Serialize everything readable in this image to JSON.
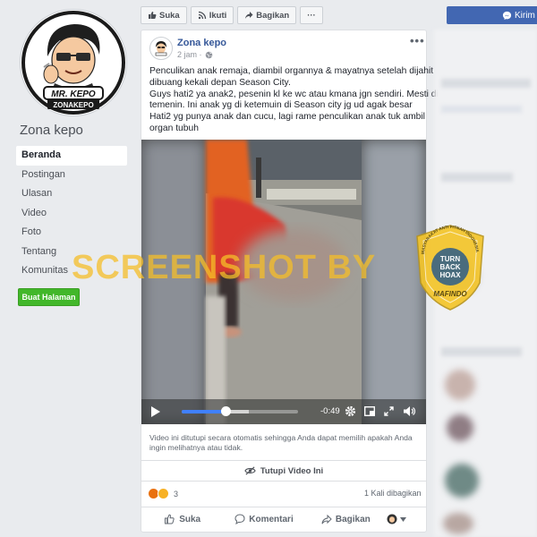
{
  "page": {
    "name": "Zona kepo",
    "logo_text_top": "MR. KEPO",
    "logo_text_bottom": "ZONAKEPO",
    "nav": [
      "Beranda",
      "Postingan",
      "Ulasan",
      "Video",
      "Foto",
      "Tentang",
      "Komunitas"
    ],
    "create_page_label": "Buat Halaman"
  },
  "topbar": {
    "like_label": "Suka",
    "follow_label": "Ikuti",
    "share_label": "Bagikan",
    "more_label": "···",
    "send_label": "Kirim"
  },
  "post": {
    "author": "Zona kepo",
    "time": "2 jam · ",
    "text_lines": [
      "Penculikan anak remaja, diambil organnya & mayatnya setelah dijahit",
      "dibuang kekali depan Season City.",
      "Guys hati2 ya anak2, pesenin kl ke wc atau kmana jgn sendiri. Mesti di",
      "temenin. Ini anak yg di ketemuin di Season city jg ud agak besar",
      "Hati2 yg punya anak dan cucu, lagi rame penculikan anak tuk ambil",
      "organ tubuh"
    ],
    "video": {
      "time_remaining": "-0:49",
      "progress": 0.38,
      "notice": "Video ini ditutupi secara otomatis sehingga Anda dapat memilih apakah Anda ingin melihatnya atau tidak.",
      "hide_label": "Tutupi Video Ini"
    },
    "reaction_count": "3",
    "shares": "1 Kali dibagikan",
    "actions": {
      "like": "Suka",
      "comment": "Komentari",
      "share": "Bagikan"
    }
  },
  "watermark": {
    "text": "SCREENSHOT BY",
    "badge_arc": "MASYARAKAT ANTI FITNAH INDONESIA",
    "badge_line1": "TURN",
    "badge_line2": "BACK",
    "badge_line3": "HOAX",
    "badge_bottom": "MAFINDO"
  },
  "colors": {
    "fb_blue": "#4267b2",
    "link_blue": "#365899",
    "green": "#42b72a",
    "watermark": "#f4be28"
  }
}
